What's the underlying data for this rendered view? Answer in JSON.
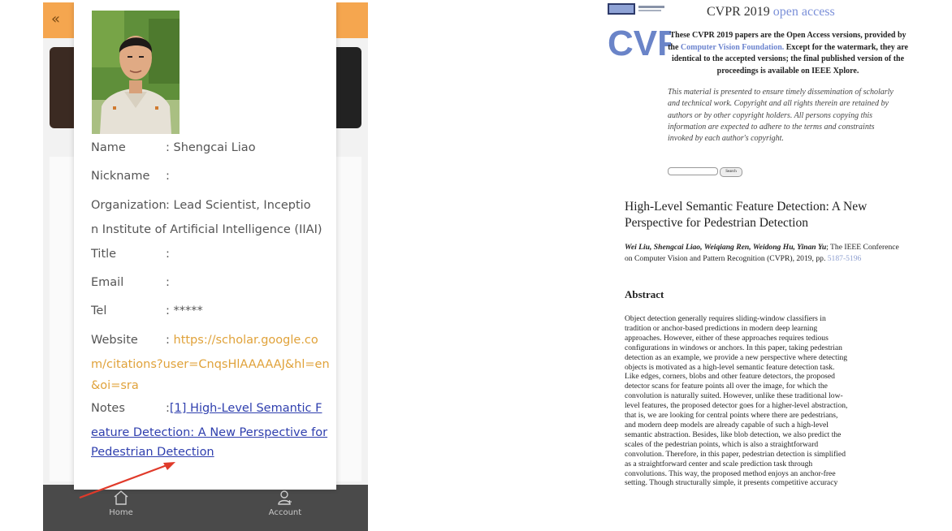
{
  "left_app": {
    "back_icon": "double-chevron-left-icon",
    "profile": {
      "name_label": "Name",
      "name_value": ": Shengcai Liao",
      "nickname_label": "Nickname",
      "nickname_value": ":",
      "organization_label": "Organization",
      "organization_value_line1": ": Lead Scientist,    Inceptio",
      "organization_value_line2": "n Institute of Artificial Intelligence (IIAI)",
      "title_label": "Title",
      "title_value": ":",
      "email_label": "Email",
      "email_value": ":",
      "tel_label": "Tel",
      "tel_value": ": *****",
      "website_label": "Website",
      "website_colon": ": ",
      "website_line1": "https://scholar.google.co",
      "website_line2": "m/citations?user=CnqsHlAAAAAJ&hl=en",
      "website_line3": "&oi=sra",
      "notes_label": "Notes",
      "notes_colon": ":",
      "notes_line1": "[1] High-Level Semantic F",
      "notes_line2": "eature Detection: A New Perspective for",
      "notes_line3": "Pedestrian Detection"
    },
    "tabbar": {
      "home_label": "Home",
      "home_icon": "home-icon",
      "account_label": "Account",
      "account_icon": "account-icon"
    },
    "colors": {
      "header": "#f5a64f",
      "tabbar": "#4a4a4a",
      "link": "#2f3fae",
      "website": "#e0a23a",
      "arrow": "#e03a2a"
    }
  },
  "right_page": {
    "logo_text": "CVF",
    "title_main": "CVPR 2019 ",
    "title_oa": "open access",
    "intro_bold_1": "These CVPR 2019 papers are the Open Access versions, provided by the ",
    "intro_link": "Computer Vision Foundation.",
    "intro_bold_2": " Except for the watermark, they are identical to the accepted versions; the final published version of the proceedings is available on IEEE Xplore.",
    "intro_italic": "This material is presented to ensure timely dissemination of scholarly and technical work. Copyright and all rights therein are retained by authors or by other copyright holders. All persons copying this information are expected to adhere to the terms and constraints invoked by each author's copyright.",
    "search_button": "Search",
    "paper_title": "High-Level Semantic Feature Detection: A New Perspective for Pedestrian Detection",
    "authors": "Wei Liu, Shengcai Liao, Weiqiang Ren, Weidong Hu, Yinan Yu",
    "venue": "; The IEEE Conference on Computer Vision and Pattern Recognition (CVPR), 2019, pp. ",
    "pages": "5187-5196",
    "abstract_heading": "Abstract",
    "abstract_lines": [
      "Object detection generally requires sliding-window classifiers in",
      "tradition or anchor-based predictions in modern deep learning",
      "approaches. However, either of these approaches requires tedious",
      "configurations in windows or anchors. In this paper, taking pedestrian",
      "detection as an example, we provide a new perspective where detecting",
      "objects is motivated as a high-level semantic feature detection task.",
      "Like edges, corners, blobs and other feature detectors, the proposed",
      "detector scans for feature points all over the image, for which the",
      "convolution is naturally suited. However, unlike these traditional low-",
      "level features, the proposed detector goes for a higher-level abstraction,",
      "that is, we are looking for central points where there are pedestrians,",
      "and modern deep models are already capable of such a high-level",
      "semantic abstraction. Besides, like blob detection, we also predict the",
      "scales of the pedestrian points, which is also a straightforward",
      "convolution. Therefore, in this paper, pedestrian detection is simplified",
      "as a straightforward center and scale prediction task through",
      "convolutions. This way, the proposed method enjoys an anchor-free",
      "setting. Though structurally simple, it presents competitive accuracy"
    ]
  }
}
